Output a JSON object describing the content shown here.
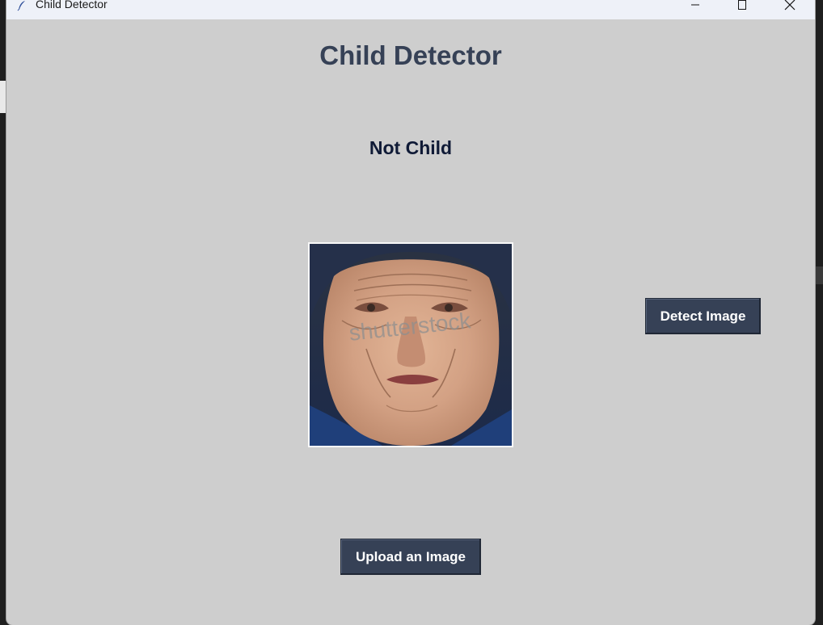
{
  "window": {
    "title": "Child Detector",
    "minimize_label": "Minimize",
    "maximize_label": "Maximize",
    "close_label": "Close"
  },
  "main": {
    "heading": "Child Detector",
    "result_label": "Not Child",
    "image_alt": "Uploaded face photo",
    "detect_button": "Detect Image",
    "upload_button": "Upload an Image"
  },
  "watermark": "shutterstock",
  "colors": {
    "window_bg": "#cecece",
    "titlebar_bg": "#eef1f8",
    "heading": "#364156",
    "result": "#0f1a36",
    "button_bg": "#364156",
    "button_text": "#ffffff"
  }
}
